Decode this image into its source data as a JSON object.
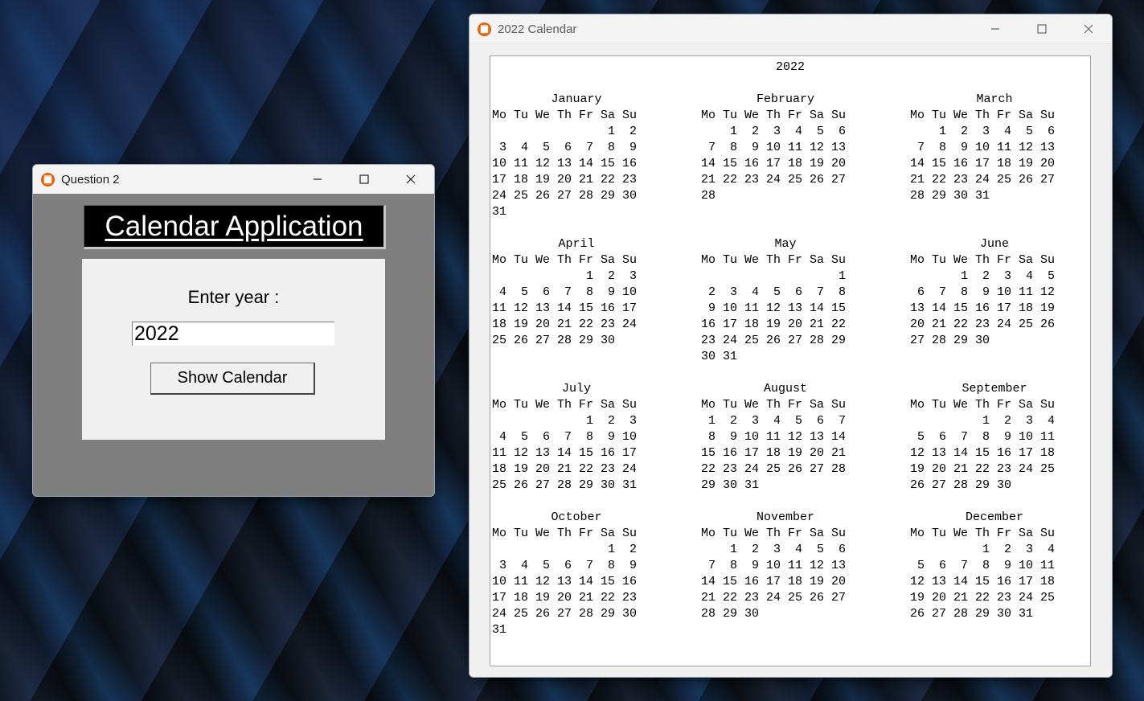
{
  "question_window": {
    "title": "Question 2",
    "heading": "Calendar Application",
    "label": "Enter year :",
    "input_value": "2022",
    "button_label": "Show Calendar"
  },
  "calendar_window": {
    "title": "2022 Calendar",
    "year_heading": "2022",
    "weekday_header": "Mo Tu We Th Fr Sa Su",
    "months": [
      {
        "name": "January",
        "rows": [
          "                1  2",
          "3  4  5  6  7  8  9",
          "10 11 12 13 14 15 16",
          "17 18 19 20 21 22 23",
          "24 25 26 27 28 29 30",
          "31"
        ]
      },
      {
        "name": "February",
        "rows": [
          "    1  2  3  4  5  6",
          " 7  8  9 10 11 12 13",
          "14 15 16 17 18 19 20",
          "21 22 23 24 25 26 27",
          "28"
        ]
      },
      {
        "name": "March",
        "rows": [
          "    1  2  3  4  5  6",
          " 7  8  9 10 11 12 13",
          "14 15 16 17 18 19 20",
          "21 22 23 24 25 26 27",
          "28 29 30 31"
        ]
      },
      {
        "name": "April",
        "rows": [
          "             1  2  3",
          " 4  5  6  7  8  9 10",
          "11 12 13 14 15 16 17",
          "18 19 20 21 22 23 24",
          "25 26 27 28 29 30"
        ]
      },
      {
        "name": "May",
        "rows": [
          "                   1",
          " 2  3  4  5  6  7  8",
          " 9 10 11 12 13 14 15",
          "16 17 18 19 20 21 22",
          "23 24 25 26 27 28 29",
          "30 31"
        ]
      },
      {
        "name": "June",
        "rows": [
          "       1  2  3  4  5",
          " 6  7  8  9 10 11 12",
          "13 14 15 16 17 18 19",
          "20 21 22 23 24 25 26",
          "27 28 29 30"
        ]
      },
      {
        "name": "July",
        "rows": [
          "             1  2  3",
          " 4  5  6  7  8  9 10",
          "11 12 13 14 15 16 17",
          "18 19 20 21 22 23 24",
          "25 26 27 28 29 30 31"
        ]
      },
      {
        "name": "August",
        "rows": [
          " 1  2  3  4  5  6  7",
          " 8  9 10 11 12 13 14",
          "15 16 17 18 19 20 21",
          "22 23 24 25 26 27 28",
          "29 30 31"
        ]
      },
      {
        "name": "September",
        "rows": [
          "          1  2  3  4",
          " 5  6  7  8  9 10 11",
          "12 13 14 15 16 17 18",
          "19 20 21 22 23 24 25",
          "26 27 28 29 30"
        ]
      },
      {
        "name": "October",
        "rows": [
          "                1  2",
          " 3  4  5  6  7  8  9",
          "10 11 12 13 14 15 16",
          "17 18 19 20 21 22 23",
          "24 25 26 27 28 29 30",
          "31"
        ]
      },
      {
        "name": "November",
        "rows": [
          "    1  2  3  4  5  6",
          " 7  8  9 10 11 12 13",
          "14 15 16 17 18 19 20",
          "21 22 23 24 25 26 27",
          "28 29 30"
        ]
      },
      {
        "name": "December",
        "rows": [
          "          1  2  3  4",
          " 5  6  7  8  9 10 11",
          "12 13 14 15 16 17 18",
          "19 20 21 22 23 24 25",
          "26 27 28 29 30 31"
        ]
      }
    ]
  },
  "icons": {
    "app": "app-calendar-icon",
    "minimize": "minimize-icon",
    "maximize": "maximize-icon",
    "close": "close-icon"
  },
  "colors": {
    "accent_icon": "#f07a22",
    "panel_gray": "#7f7f7f",
    "heading_bg": "#000000"
  }
}
